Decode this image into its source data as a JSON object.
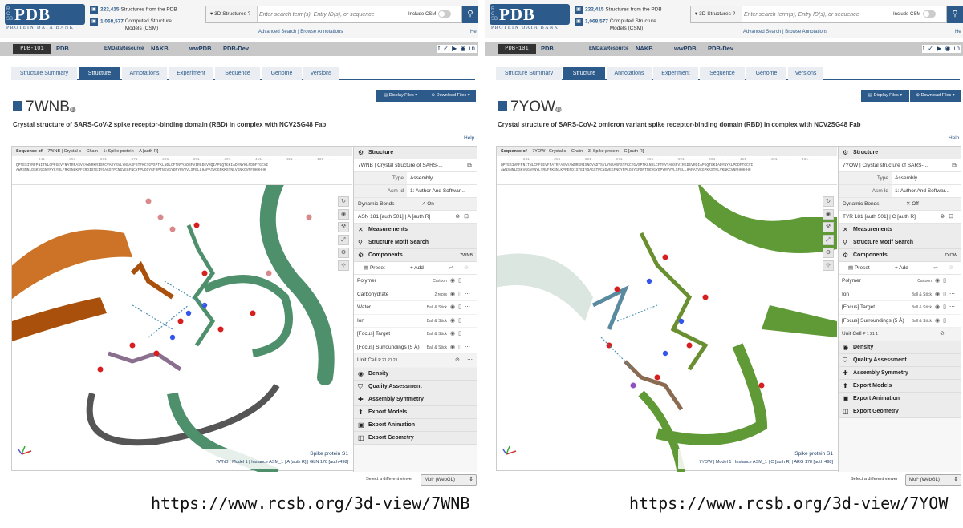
{
  "header": {
    "logo": "PDB",
    "logo_side": "RCSB",
    "logo_sub": "PROTEIN DATA BANK",
    "stat1_count": "222,415",
    "stat1_label": "Structures from the PDB",
    "stat2_count": "1,068,577",
    "stat2_label": "Computed Structure Models (CSM)",
    "search_type": "3D Structures",
    "search_placeholder": "Enter search term(s), Entry ID(s), or sequence",
    "include_csm": "Include CSM",
    "advanced": "Advanced Search | Browse Annotations",
    "help_short": "He"
  },
  "strip": {
    "pdb101": "PDB-101",
    "pdb": "PDB",
    "emdr": "EMDataResource",
    "nakb": "NAKB",
    "wwpdb": "wwPDB",
    "pdbdev": "PDB-Dev",
    "social": "f ✓ ▶ ◉ in"
  },
  "tabs": [
    "Structure Summary",
    "Structure",
    "Annotations",
    "Experiment",
    "Sequence",
    "Genome",
    "Versions"
  ],
  "buttons": {
    "display_files": "Display Files ▾",
    "download_files": "Download Files ▾"
  },
  "help": "Help",
  "viewer_labels": {
    "seq_of": "Sequence of",
    "chain": "Chain",
    "structure": "Structure",
    "type": "Type",
    "asm_id": "Asm Id",
    "dynamic_bonds": "Dynamic Bonds",
    "measurements": "Measurements",
    "motif": "Structure Motif Search",
    "components": "Components",
    "preset": "Preset",
    "add": "+ Add",
    "density": "Density",
    "quality": "Quality Assessment",
    "assembly_sym": "Assembly Symmetry",
    "export_models": "Export Models",
    "export_animation": "Export Animation",
    "export_geometry": "Export Geometry"
  },
  "select_viewer": "Select a different viewer",
  "viewer_option": "Mol* (WebGL)",
  "left": {
    "id": "7WNB",
    "title": "Crystal structure of SARS-CoV-2 spike receptor-binding domain (RBD) in complex with NCV2SG48 Fab",
    "seq_entry": "7WNB | Crystal s",
    "seq_chain": "1: Spike protein",
    "seq_auth": "A [auth R]",
    "structure_name": "7WNB | Crystal structure of SARS-...",
    "type_val": "Assembly",
    "asm_val": "1: Author And Softwar...",
    "dyn_val": "✓ On",
    "residue": "ASN 181 [auth 501] | A [auth R]",
    "comp_id": "7WNB",
    "components": [
      {
        "name": "Polymer",
        "repr": "Cartoon"
      },
      {
        "name": "Carbohydrate",
        "repr": "2 reprs"
      },
      {
        "name": "Water",
        "repr": "Ball & Stick"
      },
      {
        "name": "Ion",
        "repr": "Ball & Stick"
      },
      {
        "name": "[Focus] Target",
        "repr": "Ball & Stick"
      },
      {
        "name": "[Focus] Surroundings (5 Å)",
        "repr": "Ball & Stick"
      }
    ],
    "unit_cell": "Unit Cell",
    "unit_cell_sg": "P 21 21 21",
    "status_line1": "Spike protein S1",
    "status_line2": "7WNB | Model 1 | Instance ASM_1 | A [auth R] | GLN 178 [auth 498]",
    "url": "https://www.rcsb.org/3d-view/7WNB"
  },
  "right": {
    "id": "7YOW",
    "title": "Crystal structure of SARS-CoV-2 omicron variant spike receptor-binding domain (RBD) in complex with NCV2SG48 Fab",
    "seq_entry": "7YOW | Crystal s",
    "seq_chain": "3: Spike protein",
    "seq_auth": "C [auth R]",
    "structure_name": "7YOW | Crystal structure of SARS-...",
    "type_val": "Assembly",
    "asm_val": "1: Author And Softwar...",
    "dyn_val": "✕ Off",
    "residue": "TYR 181 [auth 501] | C [auth R]",
    "comp_id": "7YOW",
    "components": [
      {
        "name": "Polymer",
        "repr": "Cartoon"
      },
      {
        "name": "Ion",
        "repr": "Ball & Stick"
      },
      {
        "name": "[Focus] Target",
        "repr": "Ball & Stick"
      },
      {
        "name": "[Focus] Surroundings (5 Å)",
        "repr": "Ball & Stick"
      }
    ],
    "unit_cell": "Unit Cell",
    "unit_cell_sg": "P 1 21 1",
    "status_line1": "Spike protein S1",
    "status_line2": "7YOW | Model 1 | Instance ASM_1 | C [auth R] | ARG 178 [auth 498]",
    "url": "https://www.rcsb.org/3d-view/7YOW"
  },
  "colors": {
    "rcsb_blue": "#2c5a8a",
    "spike_green_left": "#4e8f6c",
    "spike_green_right": "#5f9a36",
    "fab_orange": "#c8640f"
  }
}
